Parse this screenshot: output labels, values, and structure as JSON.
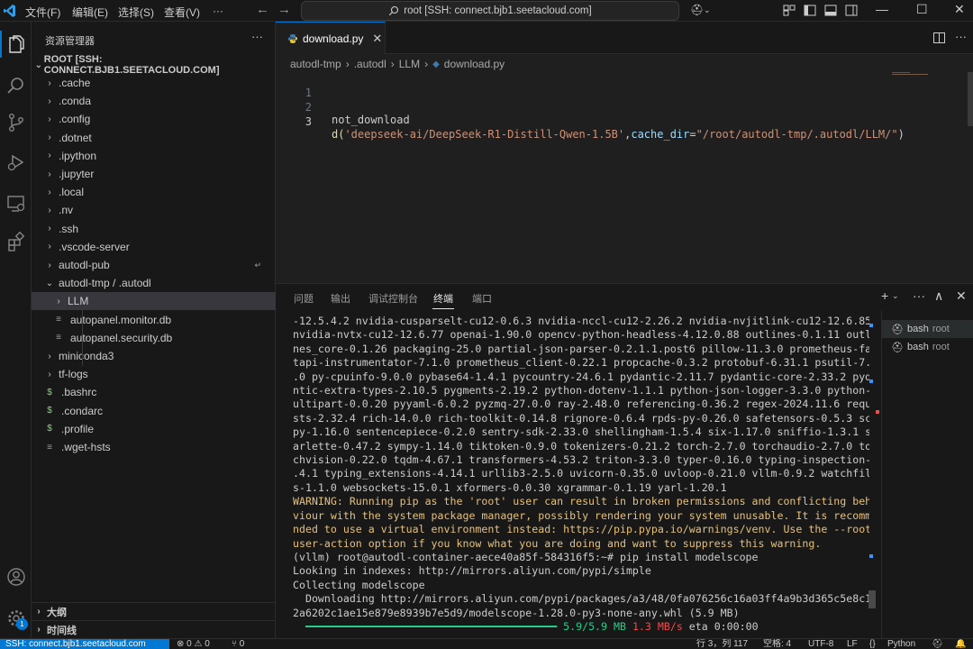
{
  "titlebar": {
    "menus": [
      "文件(F)",
      "编辑(E)",
      "选择(S)",
      "查看(V)",
      "···"
    ],
    "search_text": "root [SSH: connect.bjb1.seetacloud.com]"
  },
  "sidebar": {
    "title": "资源管理器",
    "root_label": "ROOT [SSH: CONNECT.BJB1.SEETACLOUD.COM]",
    "items": [
      {
        "label": ".cache",
        "kind": "folder"
      },
      {
        "label": ".conda",
        "kind": "folder"
      },
      {
        "label": ".config",
        "kind": "folder"
      },
      {
        "label": ".dotnet",
        "kind": "folder"
      },
      {
        "label": ".ipython",
        "kind": "folder"
      },
      {
        "label": ".jupyter",
        "kind": "folder"
      },
      {
        "label": ".local",
        "kind": "folder"
      },
      {
        "label": ".nv",
        "kind": "folder"
      },
      {
        "label": ".ssh",
        "kind": "folder"
      },
      {
        "label": ".vscode-server",
        "kind": "folder"
      },
      {
        "label": "autodl-pub",
        "kind": "folder"
      },
      {
        "label": "autodl-tmp / .autodl",
        "kind": "folder-open"
      },
      {
        "label": "LLM",
        "kind": "folder"
      },
      {
        "label": "autopanel.monitor.db",
        "kind": "file"
      },
      {
        "label": "autopanel.security.db",
        "kind": "file"
      },
      {
        "label": "miniconda3",
        "kind": "folder"
      },
      {
        "label": "tf-logs",
        "kind": "folder"
      },
      {
        "label": ".bashrc",
        "kind": "shell"
      },
      {
        "label": ".condarc",
        "kind": "shell"
      },
      {
        "label": ".profile",
        "kind": "shell"
      },
      {
        "label": ".wget-hsts",
        "kind": "file"
      }
    ],
    "outline_label": "大纲",
    "timeline_label": "时间线"
  },
  "editor": {
    "tab_label": "download.py",
    "breadcrumb": [
      "autodl-tmp",
      ".autodl",
      "LLM",
      "download.py"
    ],
    "lines": [
      {
        "num": "1",
        "text": ""
      },
      {
        "num": "2",
        "text": "not_download"
      },
      {
        "num": "3",
        "pre": "d(",
        "str1": "'deepseek-ai/DeepSeek-R1-Distill-Qwen-1.5B'",
        "mid": ",",
        "arg": "cache_dir",
        "eq": "=",
        "str2": "\"/root/autodl-tmp/.autodl/LLM/\"",
        "post": ")"
      }
    ]
  },
  "panel": {
    "tabs": [
      "问题",
      "输出",
      "调试控制台",
      "终端",
      "端口"
    ],
    "active_tab": "终端",
    "terminal_lines": [
      "-12.5.4.2 nvidia-cusparselt-cu12-0.6.3 nvidia-nccl-cu12-2.26.2 nvidia-nvjitlink-cu12-12.6.85",
      "nvidia-nvtx-cu12-12.6.77 openai-1.90.0 opencv-python-headless-4.12.0.88 outlines-0.1.11 outli",
      "nes_core-0.1.26 packaging-25.0 partial-json-parser-0.2.1.1.post6 pillow-11.3.0 prometheus-fas",
      "tapi-instrumentator-7.1.0 prometheus_client-0.22.1 propcache-0.3.2 protobuf-6.31.1 psutil-7.0",
      ".0 py-cpuinfo-9.0.0 pybase64-1.4.1 pycountry-24.6.1 pydantic-2.11.7 pydantic-core-2.33.2 pyda",
      "ntic-extra-types-2.10.5 pygments-2.19.2 python-dotenv-1.1.1 python-json-logger-3.3.0 python-m",
      "ultipart-0.0.20 pyyaml-6.0.2 pyzmq-27.0.0 ray-2.48.0 referencing-0.36.2 regex-2024.11.6 reque",
      "sts-2.32.4 rich-14.0.0 rich-toolkit-0.14.8 rignore-0.6.4 rpds-py-0.26.0 safetensors-0.5.3 sci",
      "py-1.16.0 sentencepiece-0.2.0 sentry-sdk-2.33.0 shellingham-1.5.4 six-1.17.0 sniffio-1.3.1 st",
      "arlette-0.47.2 sympy-1.14.0 tiktoken-0.9.0 tokenizers-0.21.2 torch-2.7.0 torchaudio-2.7.0 tor",
      "chvision-0.22.0 tqdm-4.67.1 transformers-4.53.2 triton-3.3.0 typer-0.16.0 typing-inspection-0",
      ".4.1 typing_extensions-4.14.1 urllib3-2.5.0 uvicorn-0.35.0 uvloop-0.21.0 vllm-0.9.2 watchfile",
      "s-1.1.0 websockets-15.0.1 xformers-0.0.30 xgrammar-0.1.19 yarl-1.20.1"
    ],
    "warning_lines": [
      "WARNING: Running pip as the 'root' user can result in broken permissions and conflicting beha",
      "viour with the system package manager, possibly rendering your system unusable. It is recomme",
      "nded to use a virtual environment instead: https://pip.pypa.io/warnings/venv. Use the --root-",
      "user-action option if you know what you are doing and want to suppress this warning."
    ],
    "command_line": "(vllm) root@autodl-container-aece40a85f-584316f5:~# pip install modelscope",
    "after_lines": [
      "Looking in indexes: http://mirrors.aliyun.com/pypi/simple",
      "Collecting modelscope",
      "  Downloading http://mirrors.aliyun.com/pypi/packages/a3/48/0fa076256c16a03ff4a9b3d365c5e8c18",
      "2a6202c1ae15e879e8939b7e5d9/modelscope-1.28.0-py3-none-any.whl (5.9 MB)"
    ],
    "progress_text": "5.9/5.9 MB",
    "speed_text": "1.3 MB/s",
    "eta_text": "eta 0:00:00",
    "progress": 1.0,
    "terminals": [
      {
        "name": "bash",
        "sub": "root"
      },
      {
        "name": "bash",
        "sub": "root"
      }
    ]
  },
  "statusbar": {
    "remote": "SSH: connect.bjb1.seetacloud.com",
    "errors": "⊗ 0 ⚠ 0",
    "ports": "⑂ 0",
    "position": "行 3，列 117",
    "spaces": "空格: 4",
    "encoding": "UTF-8",
    "eol": "LF",
    "language": "Python",
    "braces": "{}"
  },
  "colors": {
    "accent": "#0078d4",
    "warning": "#e5c07b",
    "success": "#23d18b",
    "string": "#ce9178"
  },
  "notification_count": "1"
}
